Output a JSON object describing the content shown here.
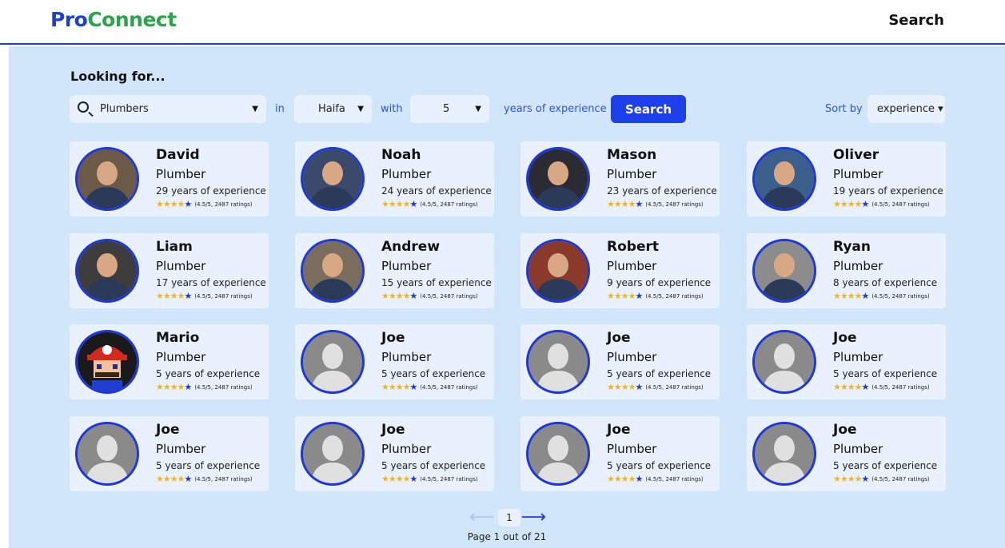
{
  "header": {
    "logo_part1": "Pro",
    "logo_part2": "Connect",
    "nav_search": "Search"
  },
  "filters": {
    "heading": "Looking for...",
    "profession": "Plumbers",
    "in_label": "in",
    "city": "Haifa",
    "with_label": "with",
    "years": "5",
    "years_suffix": "years of experience",
    "search_button": "Search",
    "sort_label": "Sort by",
    "sort_value": "experience ▾"
  },
  "colors": {
    "accent": "#1e40ea",
    "brand_green": "#2aa54a",
    "background": "#d2e6fb",
    "card": "#e8f1fd",
    "star": "#f2b51b"
  },
  "cards": [
    {
      "name": "David",
      "title": "Plumber",
      "experience": "29 years of experience",
      "rating": "(4.5/5, 2487 ratings)",
      "avatar": "photo",
      "avatar_color": "#6b5a48"
    },
    {
      "name": "Noah",
      "title": "Plumber",
      "experience": "24 years of experience",
      "rating": "(4.5/5, 2487 ratings)",
      "avatar": "photo",
      "avatar_color": "#3b4a6b"
    },
    {
      "name": "Mason",
      "title": "Plumber",
      "experience": "23 years of experience",
      "rating": "(4.5/5, 2487 ratings)",
      "avatar": "photo",
      "avatar_color": "#2b2b33"
    },
    {
      "name": "Oliver",
      "title": "Plumber",
      "experience": "19 years of experience",
      "rating": "(4.5/5, 2487 ratings)",
      "avatar": "photo",
      "avatar_color": "#3a5f8a"
    },
    {
      "name": "Liam",
      "title": "Plumber",
      "experience": "17 years of experience",
      "rating": "(4.5/5, 2487 ratings)",
      "avatar": "photo",
      "avatar_color": "#3d3d3d"
    },
    {
      "name": "Andrew",
      "title": "Plumber",
      "experience": "15 years of experience",
      "rating": "(4.5/5, 2487 ratings)",
      "avatar": "photo",
      "avatar_color": "#7a6d5e"
    },
    {
      "name": "Robert",
      "title": "Plumber",
      "experience": "9 years of experience",
      "rating": "(4.5/5, 2487 ratings)",
      "avatar": "photo",
      "avatar_color": "#8a3a2a"
    },
    {
      "name": "Ryan",
      "title": "Plumber",
      "experience": "8 years of experience",
      "rating": "(4.5/5, 2487 ratings)",
      "avatar": "photo",
      "avatar_color": "#8c8c8c"
    },
    {
      "name": "Mario",
      "title": "Plumber",
      "experience": "5 years of experience",
      "rating": "(4.5/5, 2487 ratings)",
      "avatar": "mario",
      "avatar_color": "#c8221c"
    },
    {
      "name": "Joe",
      "title": "Plumber",
      "experience": "5 years of experience",
      "rating": "(4.5/5, 2487 ratings)",
      "avatar": "placeholder",
      "avatar_color": "#8a8a8a"
    },
    {
      "name": "Joe",
      "title": "Plumber",
      "experience": "5 years of experience",
      "rating": "(4.5/5, 2487 ratings)",
      "avatar": "placeholder",
      "avatar_color": "#8a8a8a"
    },
    {
      "name": "Joe",
      "title": "Plumber",
      "experience": "5 years of experience",
      "rating": "(4.5/5, 2487 ratings)",
      "avatar": "placeholder",
      "avatar_color": "#8a8a8a"
    },
    {
      "name": "Joe",
      "title": "Plumber",
      "experience": "5 years of experience",
      "rating": "(4.5/5, 2487 ratings)",
      "avatar": "placeholder",
      "avatar_color": "#8a8a8a"
    },
    {
      "name": "Joe",
      "title": "Plumber",
      "experience": "5 years of experience",
      "rating": "(4.5/5, 2487 ratings)",
      "avatar": "placeholder",
      "avatar_color": "#8a8a8a"
    },
    {
      "name": "Joe",
      "title": "Plumber",
      "experience": "5 years of experience",
      "rating": "(4.5/5, 2487 ratings)",
      "avatar": "placeholder",
      "avatar_color": "#8a8a8a"
    },
    {
      "name": "Joe",
      "title": "Plumber",
      "experience": "5 years of experience",
      "rating": "(4.5/5, 2487 ratings)",
      "avatar": "placeholder",
      "avatar_color": "#8a8a8a"
    }
  ],
  "pagination": {
    "current": "1",
    "info": "Page 1 out of 21",
    "prev_icon": "arrow-left-icon",
    "next_icon": "arrow-right-icon"
  }
}
